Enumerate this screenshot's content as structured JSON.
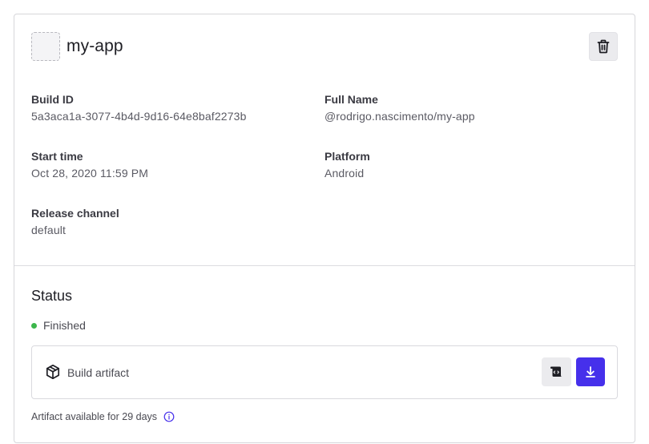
{
  "app": {
    "name": "my-app"
  },
  "details": {
    "build_id": {
      "label": "Build ID",
      "value": "5a3aca1a-3077-4b4d-9d16-64e8baf2273b"
    },
    "full_name": {
      "label": "Full Name",
      "value": "@rodrigo.nascimento/my-app"
    },
    "start_time": {
      "label": "Start time",
      "value": "Oct 28, 2020 11:59 PM"
    },
    "platform": {
      "label": "Platform",
      "value": "Android"
    },
    "release_channel": {
      "label": "Release channel",
      "value": "default"
    }
  },
  "status": {
    "title": "Status",
    "value": "Finished",
    "color": "#3cb64b"
  },
  "artifact": {
    "label": "Build artifact",
    "icon": "package-icon",
    "logs_icon": "logs-scroll-icon",
    "download_icon": "download-icon",
    "availability": "Artifact available for 29 days"
  },
  "colors": {
    "accent": "#4630eb",
    "success": "#3cb64b"
  }
}
